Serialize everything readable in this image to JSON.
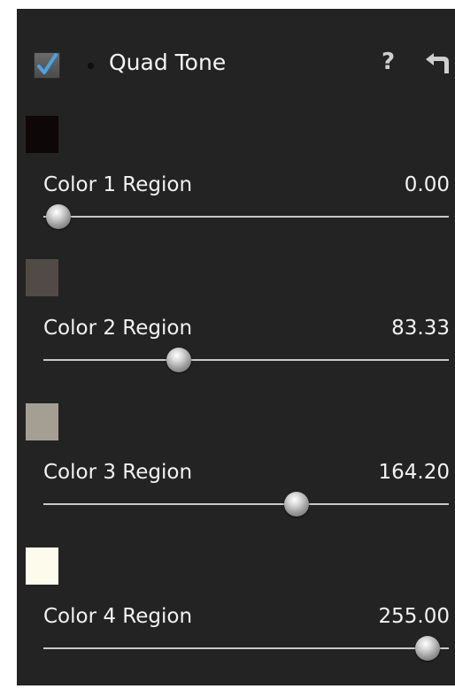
{
  "header": {
    "enabled": true,
    "title": "Quad Tone",
    "help_glyph": "?",
    "reset_icon": "reset-arrow-icon",
    "checkbox_color": "#4ba3e0"
  },
  "slider_range": [
    0,
    255
  ],
  "regions": [
    {
      "color": "#0e0707",
      "label": "Color 1 Region",
      "value": "0.00"
    },
    {
      "color": "#514a47",
      "label": "Color 2 Region",
      "value": "83.33"
    },
    {
      "color": "#a59f93",
      "label": "Color 3 Region",
      "value": "164.20"
    },
    {
      "color": "#fcfbec",
      "label": "Color 4 Region",
      "value": "255.00"
    }
  ]
}
